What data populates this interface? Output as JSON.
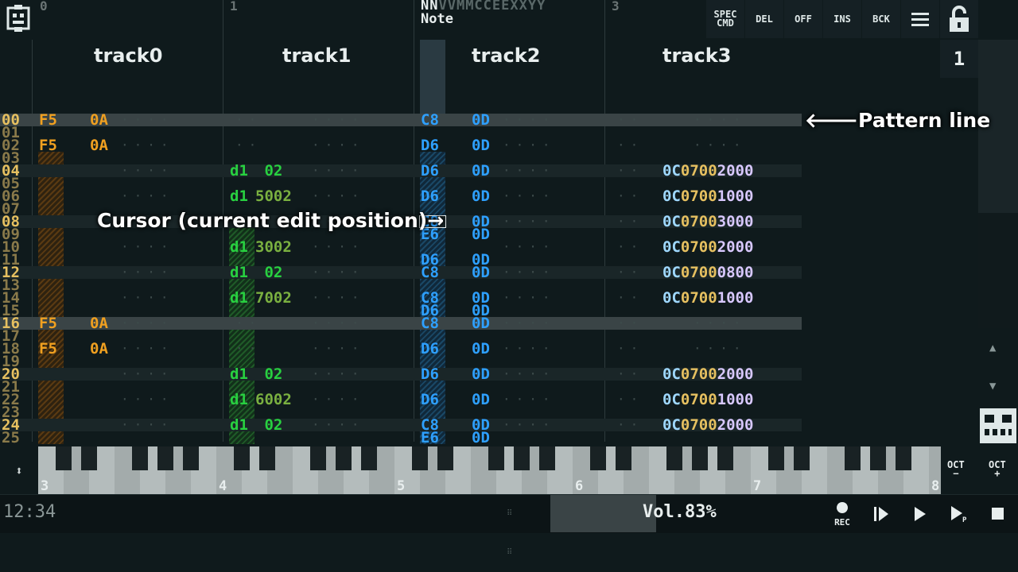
{
  "header": {
    "column_numbers": [
      "0",
      "1",
      "2",
      "3"
    ],
    "nn_label_bright": "NN",
    "nn_label_dim": "VVMMCCEEXXYY",
    "note_label": "Note",
    "buttons": [
      {
        "id": "spec",
        "label_line1": "SPEC",
        "label_line2": "CMD"
      },
      {
        "id": "del",
        "label_line1": "DEL",
        "label_line2": ""
      },
      {
        "id": "off",
        "label_line1": "OFF",
        "label_line2": ""
      },
      {
        "id": "ins",
        "label_line1": "INS",
        "label_line2": ""
      },
      {
        "id": "bck",
        "label_line1": "BCK",
        "label_line2": ""
      }
    ],
    "step_value": "1"
  },
  "tracks": [
    "track0",
    "track1",
    "track2",
    "track3"
  ],
  "rows": [
    {
      "n": "00",
      "t0": {
        "note": "F5",
        "val": "0A"
      },
      "t1": null,
      "t2": {
        "note": "C8",
        "val": "0D"
      },
      "t3": null
    },
    {
      "n": "01",
      "t0": null,
      "t1": null,
      "t2": null,
      "t3": null
    },
    {
      "n": "02",
      "t0": {
        "note": "F5",
        "val": "0A"
      },
      "t1": null,
      "t2": {
        "note": "D6",
        "val": "0D"
      },
      "t3": null
    },
    {
      "n": "03",
      "t0": null,
      "t1": null,
      "t2": null,
      "t3": null
    },
    {
      "n": "04",
      "t0": null,
      "t1": {
        "note": "d1",
        "val": " 02"
      },
      "t2": {
        "note": "D6",
        "val": "0D"
      },
      "t3": {
        "a": "0C",
        "b": "0700",
        "c": "2000"
      }
    },
    {
      "n": "05",
      "t0": null,
      "t1": null,
      "t2": null,
      "t3": null
    },
    {
      "n": "06",
      "t0": null,
      "t1": {
        "note": "d1",
        "val": "5002"
      },
      "t2": {
        "note": "D6",
        "val": "0D"
      },
      "t3": {
        "a": "0C",
        "b": "0700",
        "c": "1000"
      }
    },
    {
      "n": "07",
      "t0": null,
      "t1": null,
      "t2": null,
      "t3": null
    },
    {
      "n": "08",
      "t0": null,
      "t1": null,
      "t2": {
        "note": "C8",
        "val": "0D"
      },
      "t3": {
        "a": "0C",
        "b": "0700",
        "c": "3000"
      }
    },
    {
      "n": "09",
      "t0": null,
      "t1": null,
      "t2": {
        "note": "E6",
        "val": "0D"
      },
      "t3": null
    },
    {
      "n": "10",
      "t0": null,
      "t1": {
        "note": "d1",
        "val": "3002"
      },
      "t2": null,
      "t3": {
        "a": "0C",
        "b": "0700",
        "c": "2000"
      }
    },
    {
      "n": "11",
      "t0": null,
      "t1": null,
      "t2": {
        "note": "D6",
        "val": "0D"
      },
      "t3": null
    },
    {
      "n": "12",
      "t0": null,
      "t1": {
        "note": "d1",
        "val": " 02"
      },
      "t2": {
        "note": "C8",
        "val": "0D"
      },
      "t3": {
        "a": "0C",
        "b": "0700",
        "c": "0800"
      }
    },
    {
      "n": "13",
      "t0": null,
      "t1": null,
      "t2": null,
      "t3": null
    },
    {
      "n": "14",
      "t0": null,
      "t1": {
        "note": "d1",
        "val": "7002"
      },
      "t2": {
        "note": "C8",
        "val": "0D"
      },
      "t3": {
        "a": "0C",
        "b": "0700",
        "c": "1000"
      }
    },
    {
      "n": "15",
      "t0": null,
      "t1": null,
      "t2": {
        "note": "D6",
        "val": "0D"
      },
      "t3": null
    },
    {
      "n": "16",
      "t0": {
        "note": "F5",
        "val": "0A"
      },
      "t1": null,
      "t2": {
        "note": "C8",
        "val": "0D"
      },
      "t3": null
    },
    {
      "n": "17",
      "t0": null,
      "t1": null,
      "t2": null,
      "t3": null
    },
    {
      "n": "18",
      "t0": {
        "note": "F5",
        "val": "0A"
      },
      "t1": null,
      "t2": {
        "note": "D6",
        "val": "0D"
      },
      "t3": null
    },
    {
      "n": "19",
      "t0": null,
      "t1": null,
      "t2": null,
      "t3": null
    },
    {
      "n": "20",
      "t0": null,
      "t1": {
        "note": "d1",
        "val": " 02"
      },
      "t2": {
        "note": "D6",
        "val": "0D"
      },
      "t3": {
        "a": "0C",
        "b": "0700",
        "c": "2000"
      }
    },
    {
      "n": "21",
      "t0": null,
      "t1": null,
      "t2": null,
      "t3": null
    },
    {
      "n": "22",
      "t0": null,
      "t1": {
        "note": "d1",
        "val": "6002"
      },
      "t2": {
        "note": "D6",
        "val": "0D"
      },
      "t3": {
        "a": "0C",
        "b": "0700",
        "c": "1000"
      }
    },
    {
      "n": "23",
      "t0": null,
      "t1": null,
      "t2": null,
      "t3": null
    },
    {
      "n": "24",
      "t0": null,
      "t1": {
        "note": "d1",
        "val": " 02"
      },
      "t2": {
        "note": "C8",
        "val": "0D"
      },
      "t3": {
        "a": "0C",
        "b": "0700",
        "c": "2000"
      }
    },
    {
      "n": "25",
      "t0": null,
      "t1": null,
      "t2": {
        "note": "E6",
        "val": "0D"
      },
      "t3": null
    }
  ],
  "annotations": {
    "pattern_line": "Pattern line",
    "cursor": "Cursor (current edit position)"
  },
  "piano": {
    "octave_labels": [
      "3",
      "4",
      "5",
      "6",
      "7",
      "8"
    ],
    "oct_down": "OCT",
    "oct_down_sign": "−",
    "oct_up": "OCT",
    "oct_up_sign": "+"
  },
  "status": {
    "time": "12:34",
    "volume": "Vol.83%",
    "rec_label": "REC"
  },
  "colors": {
    "orange": "#f0a020",
    "green": "#28d040",
    "cyan": "#2ea0ff",
    "yellow": "#e6c060",
    "light_blue": "#9fd8ff",
    "highlight": "#3a4446"
  }
}
